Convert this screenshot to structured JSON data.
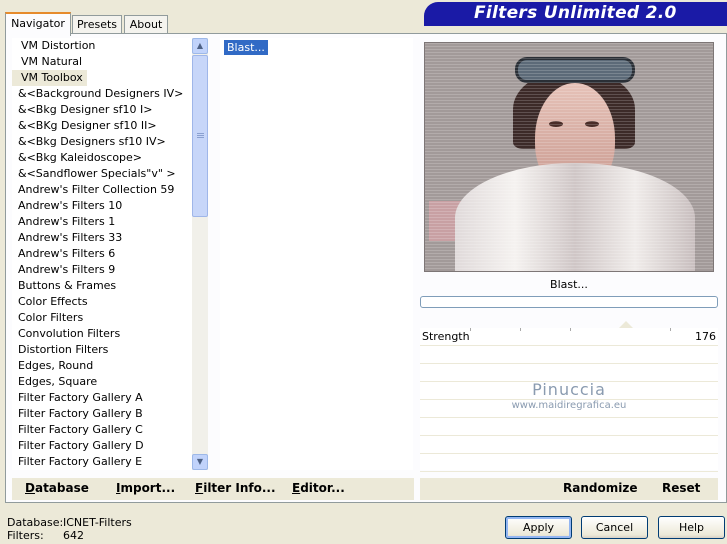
{
  "tabs": [
    {
      "label": "Navigator",
      "active": true
    },
    {
      "label": "Presets",
      "active": false
    },
    {
      "label": "About",
      "active": false
    }
  ],
  "banner": {
    "title": "Filters Unlimited 2.0"
  },
  "categories": [
    "VM Distortion",
    "VM Natural",
    "VM Toolbox",
    "&<Background Designers IV>",
    "&<Bkg Designer sf10 I>",
    "&<BKg Designer sf10 II>",
    "&<Bkg Designers sf10 IV>",
    "&<Bkg Kaleidoscope>",
    "&<Sandflower Specials\"v\" >",
    "Andrew's Filter Collection 59",
    "Andrew's Filters 10",
    "Andrew's Filters 1",
    "Andrew's Filters 33",
    "Andrew's Filters 6",
    "Andrew's Filters 9",
    "Buttons & Frames",
    "Color Effects",
    "Color Filters",
    "Convolution Filters",
    "Distortion Filters",
    "Edges, Round",
    "Edges, Square",
    "Filter Factory Gallery A",
    "Filter Factory Gallery B",
    "Filter Factory Gallery C",
    "Filter Factory Gallery D",
    "Filter Factory Gallery E"
  ],
  "selected_category": "VM Toolbox",
  "filters": [
    "Blast..."
  ],
  "selected_filter_label": "Blast...",
  "progress": 0,
  "parameters": [
    {
      "name": "Strength",
      "value": "176"
    }
  ],
  "watermark": {
    "name": "Pinuccia",
    "url": "www.maidiregrafica.eu"
  },
  "toolbar": {
    "database": {
      "ul": "D",
      "rest": "atabase"
    },
    "import": {
      "ul": "I",
      "rest": "mport..."
    },
    "filter_info": {
      "ul": "F",
      "rest": "ilter Info..."
    },
    "editor": {
      "ul": "E",
      "rest": "ditor..."
    },
    "randomize": "Randomize",
    "reset": "Reset"
  },
  "status": {
    "db_label": "Database:",
    "db_value": "ICNET-Filters",
    "filters_label": "Filters:",
    "filters_value": "642"
  },
  "buttons": {
    "apply": "Apply",
    "cancel": "Cancel",
    "help": "Help"
  },
  "colors": {
    "banner": "#1a1aa6",
    "selection": "#316ac5",
    "tab_accent": "#e68b2c"
  }
}
